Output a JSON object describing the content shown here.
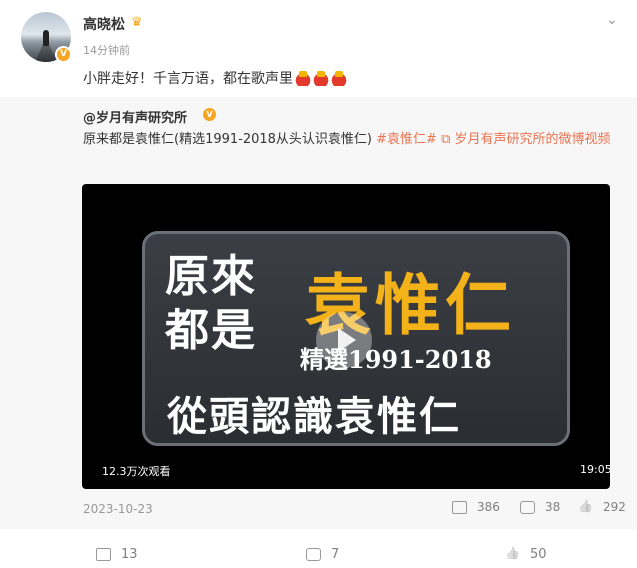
{
  "post": {
    "author": "高晓松",
    "time": "14分钟前",
    "text": "小胖走好！千言万语，都在歌声里",
    "icons": {
      "verified": "verified-badge-icon",
      "crown": "crown-icon",
      "more": "chevron-down-icon",
      "emoji": "candle-emoji-icon"
    }
  },
  "repost": {
    "author": "@岁月有声研究所",
    "text": "原来都是袁惟仁(精选1991-2018从头认识袁惟仁)",
    "tag1": "#袁惟仁#",
    "tag2": "岁月有声研究所的微博视频",
    "video": {
      "line1": "原來",
      "line2": "都是",
      "title": "袁惟仁",
      "subtitle": "精選1991-2018",
      "bottom": "從頭認識袁惟仁",
      "views": "12.3万次观看",
      "duration": "19:05"
    },
    "date": "2023-10-23",
    "reposts": "386",
    "comments": "38",
    "likes": "292"
  },
  "actions": {
    "reposts": "13",
    "comments": "7",
    "likes": "50"
  }
}
